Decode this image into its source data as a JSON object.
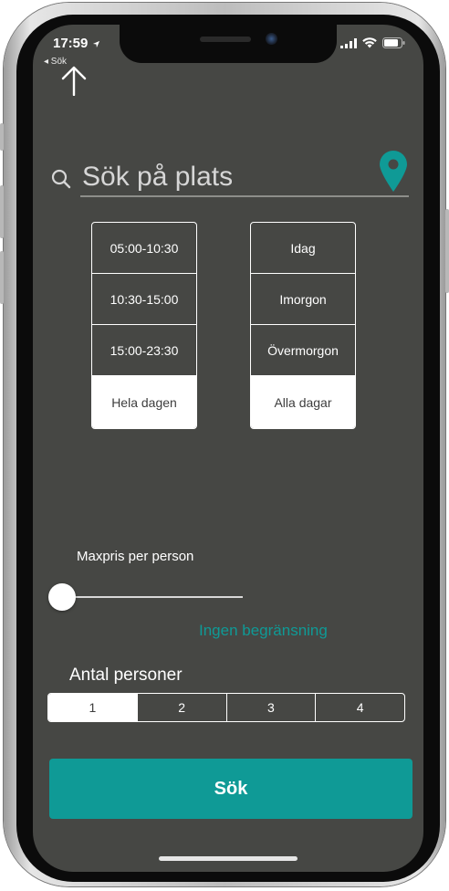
{
  "status_bar": {
    "time": "17:59",
    "back_label": "◂ Sök"
  },
  "search": {
    "placeholder": "Sök på plats"
  },
  "time_options": [
    {
      "label": "05:00-10:30",
      "selected": false
    },
    {
      "label": "10:30-15:00",
      "selected": false
    },
    {
      "label": "15:00-23:30",
      "selected": false
    },
    {
      "label": "Hela dagen",
      "selected": true
    }
  ],
  "day_options": [
    {
      "label": "Idag",
      "selected": false
    },
    {
      "label": "Imorgon",
      "selected": false
    },
    {
      "label": "Övermorgon",
      "selected": false
    },
    {
      "label": "Alla dagar",
      "selected": true
    }
  ],
  "price": {
    "label": "Maxpris per person",
    "value_text": "Ingen begränsning",
    "slider_fraction": 0
  },
  "persons": {
    "label": "Antal personer",
    "options": [
      "1",
      "2",
      "3",
      "4"
    ],
    "selected_index": 0
  },
  "submit": {
    "label": "Sök"
  },
  "colors": {
    "background": "#464744",
    "accent": "#0f9a96",
    "text": "#ffffff"
  },
  "icons": [
    "up-arrow-icon",
    "search-icon",
    "location-pin-icon",
    "signal-icon",
    "wifi-icon",
    "battery-icon"
  ]
}
